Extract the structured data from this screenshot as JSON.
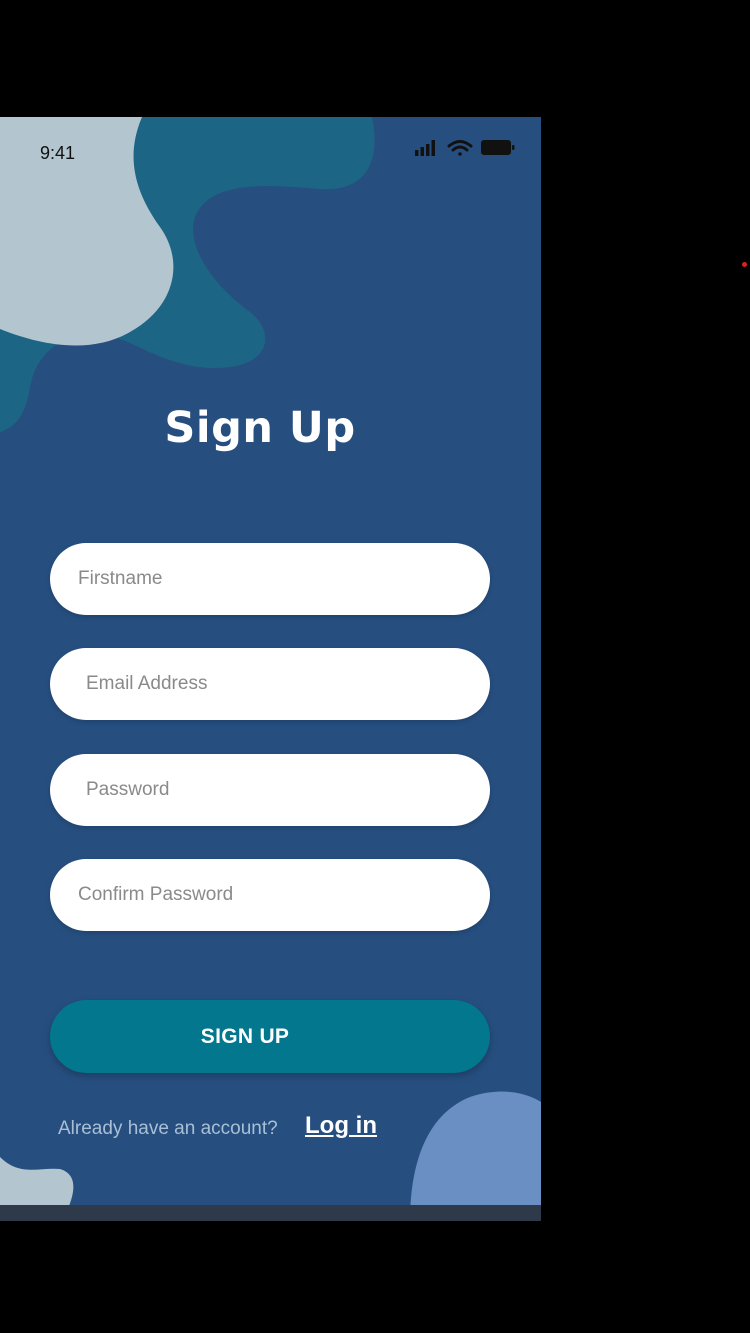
{
  "status_bar": {
    "time": "9:41",
    "icons": [
      "signal-icon",
      "wifi-icon",
      "battery-icon"
    ]
  },
  "title": "Sign Up",
  "form": {
    "firstname_placeholder": "Firstname",
    "email_placeholder": "Email Address",
    "password_placeholder": "Password",
    "confirm_password_placeholder": "Confirm Password"
  },
  "signup_button_label": "SIGN UP",
  "footer": {
    "question": "Already have an account?",
    "login_label": "Log in"
  },
  "colors": {
    "background": "#264f80",
    "button": "#02778e",
    "blob_light": "#b3c5cf",
    "blob_teal": "#1d6585",
    "blob_blue": "#6a8fc2"
  }
}
